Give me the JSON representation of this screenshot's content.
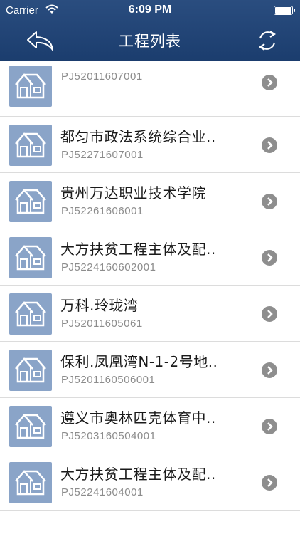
{
  "status_bar": {
    "carrier": "Carrier",
    "time": "6:09 PM"
  },
  "nav": {
    "title": "工程列表",
    "back_icon": "back-arrow-icon",
    "refresh_icon": "refresh-icon"
  },
  "colors": {
    "nav_bar": "#1e4273",
    "thumbnail": "#8aa4c8",
    "chevron": "#8e8e8e"
  },
  "projects": [
    {
      "title": "",
      "code": "PJ52011607001"
    },
    {
      "title": "都匀市政法系统综合业..",
      "code": "PJ52271607001"
    },
    {
      "title": "贵州万达职业技术学院",
      "code": "PJ52261606001"
    },
    {
      "title": "大方扶贫工程主体及配..",
      "code": "PJ5224160602001"
    },
    {
      "title": "万科.玲珑湾",
      "code": "PJ52011605061"
    },
    {
      "title": "保利.凤凰湾N-1-2号地..",
      "code": "PJ5201160506001"
    },
    {
      "title": "遵义市奥林匹克体育中..",
      "code": "PJ5203160504001"
    },
    {
      "title": "大方扶贫工程主体及配..",
      "code": "PJ52241604001"
    }
  ]
}
